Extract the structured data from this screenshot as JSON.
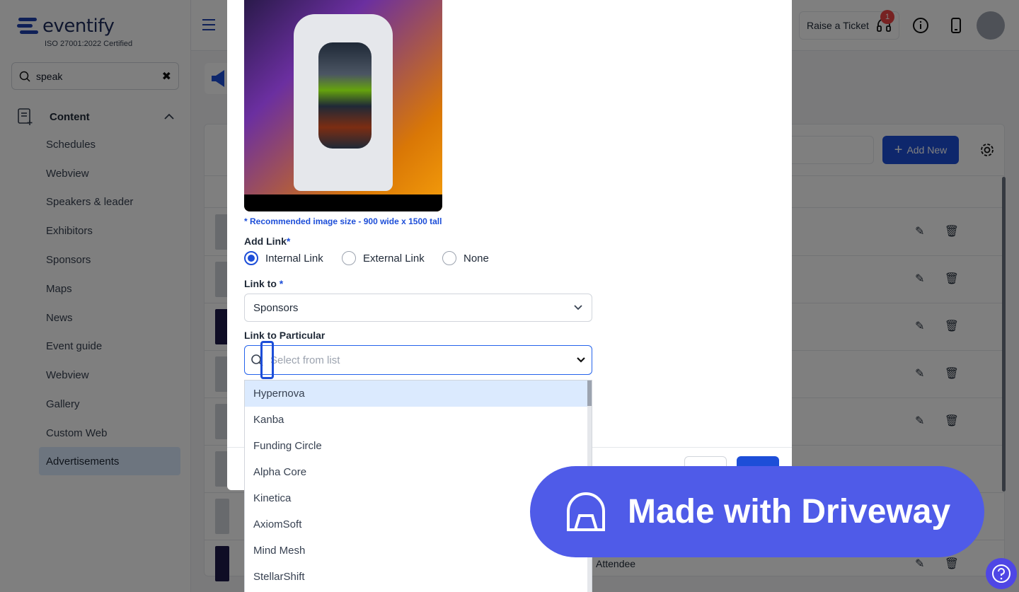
{
  "brand": {
    "logo": "eventify",
    "certification": "ISO 27001:2022 Certified"
  },
  "sidebar": {
    "search_value": "speak",
    "section_label": "Content",
    "items": [
      {
        "label": "Schedules"
      },
      {
        "label": "Webview"
      },
      {
        "label": "Speakers & leader"
      },
      {
        "label": "Exhibitors"
      },
      {
        "label": "Sponsors"
      },
      {
        "label": "Maps"
      },
      {
        "label": "News"
      },
      {
        "label": "Event guide"
      },
      {
        "label": "Webview"
      },
      {
        "label": "Gallery"
      },
      {
        "label": "Custom Web"
      },
      {
        "label": "Advertisements"
      }
    ],
    "active_item": "Advertisements"
  },
  "topbar": {
    "ticket_label": "Raise a Ticket",
    "ticket_badge": "1"
  },
  "main": {
    "add_new_label": "Add New",
    "row_text": "Attendee"
  },
  "modal": {
    "image_note": "* Recommended image size - 900 wide x 1500 tall",
    "add_link_label": "Add Link",
    "required_mark": "*",
    "link_options": [
      {
        "label": "Internal Link",
        "selected": true
      },
      {
        "label": "External Link",
        "selected": false
      },
      {
        "label": "None",
        "selected": false
      }
    ],
    "link_to_label": "Link to",
    "link_to_value": "Sponsors",
    "particular_label": "Link to Particular",
    "particular_placeholder": "Select from list",
    "dropdown_options": [
      "Hypernova",
      "Kanba",
      "Funding Circle",
      "Alpha Core",
      "Kinetica",
      "AxiomSoft",
      "Mind Mesh",
      "StellarShift"
    ],
    "highlighted_option": "Hypernova"
  },
  "watermark": {
    "text": "Made with Driveway"
  },
  "colors": {
    "primary": "#1d4ed8",
    "highlight": "#dbeafe",
    "watermark": "#4f5be8"
  }
}
